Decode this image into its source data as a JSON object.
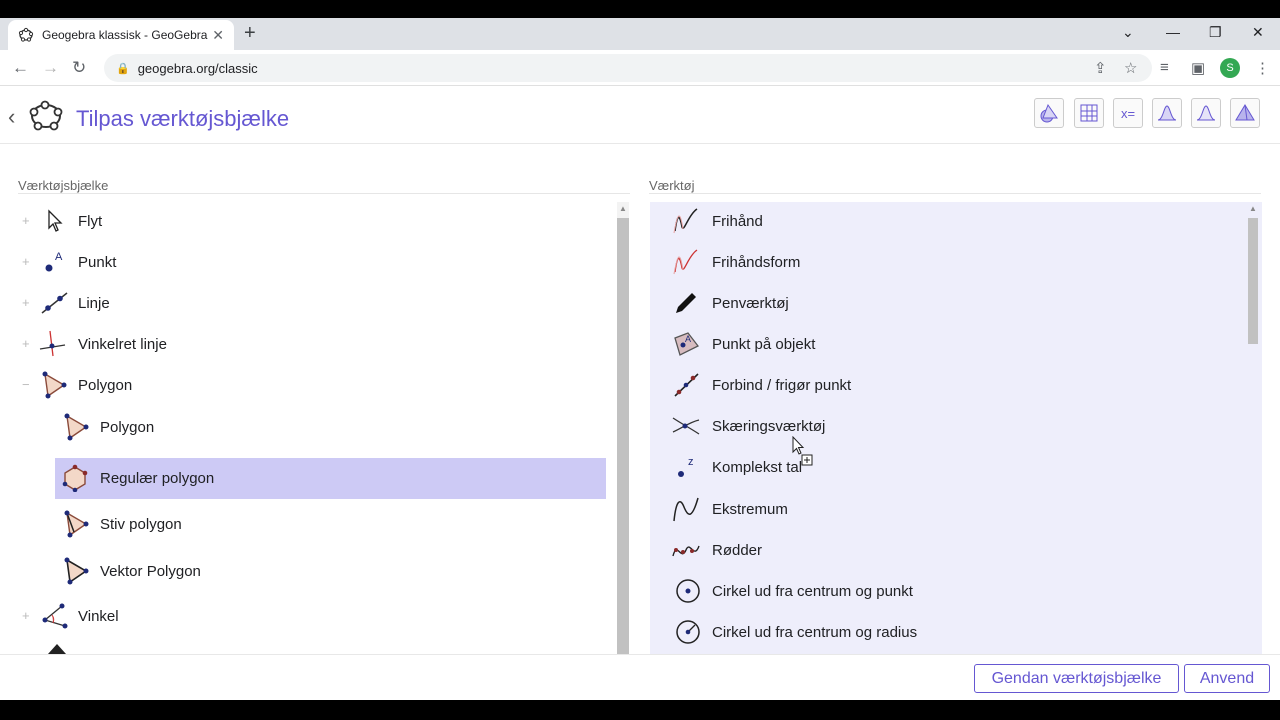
{
  "browser": {
    "tab_title": "Geogebra klassisk - GeoGebra",
    "url": "geogebra.org/classic",
    "profile_initial": "S"
  },
  "header": {
    "title": "Tilpas værktøjsbjælke"
  },
  "left_panel": {
    "label": "Værktøjsbjælke",
    "items": [
      {
        "label": "Flyt",
        "expander": "+"
      },
      {
        "label": "Punkt",
        "expander": "+"
      },
      {
        "label": "Linje",
        "expander": "+"
      },
      {
        "label": "Vinkelret linje",
        "expander": "+"
      },
      {
        "label": "Polygon",
        "expander": "−"
      },
      {
        "label": "Polygon"
      },
      {
        "label": "Regulær polygon"
      },
      {
        "label": "Stiv polygon"
      },
      {
        "label": "Vektor Polygon"
      },
      {
        "label": "Vinkel",
        "expander": "+"
      }
    ]
  },
  "right_panel": {
    "label": "Værktøj",
    "items": [
      "Frihånd",
      "Frihåndsform",
      "Penværktøj",
      "Punkt på objekt",
      "Forbind / frigør punkt",
      "Skæringsværktøj",
      "Komplekst tal",
      "Ekstremum",
      "Rødder",
      "Cirkel ud fra centrum og punkt",
      "Cirkel ud fra centrum og radius"
    ]
  },
  "footer": {
    "restore_label": "Gendan værktøjsbjælke",
    "apply_label": "Anvend"
  },
  "colors": {
    "accent": "#6557d2",
    "selected_row": "#cdcaf5",
    "right_panel_bg": "#eeeefb"
  }
}
